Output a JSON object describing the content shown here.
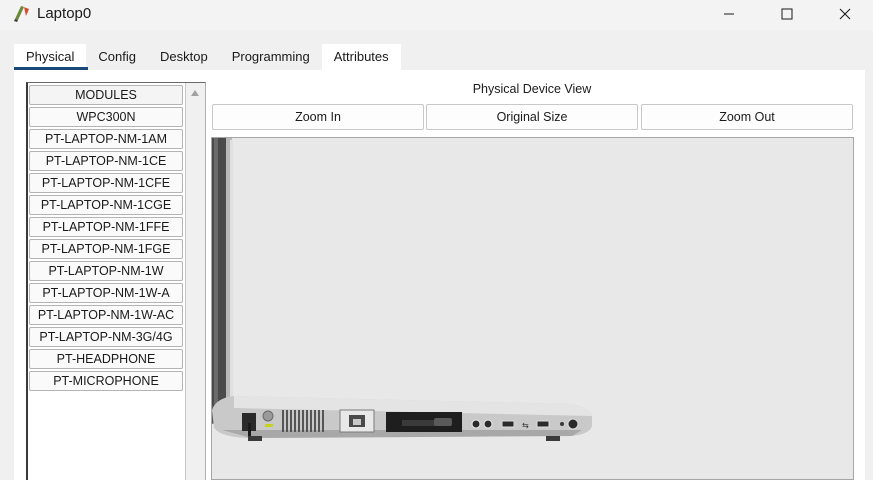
{
  "window": {
    "title": "Laptop0",
    "icon": "laptop-app-icon",
    "controls": [
      "minimize-icon",
      "maximize-icon",
      "close-icon"
    ]
  },
  "tabs": [
    {
      "label": "Physical",
      "active": true
    },
    {
      "label": "Config",
      "active": false
    },
    {
      "label": "Desktop",
      "active": false
    },
    {
      "label": "Programming",
      "active": false
    },
    {
      "label": "Attributes",
      "active": false
    }
  ],
  "modules": {
    "header": "MODULES",
    "items": [
      "WPC300N",
      "PT-LAPTOP-NM-1AM",
      "PT-LAPTOP-NM-1CE",
      "PT-LAPTOP-NM-1CFE",
      "PT-LAPTOP-NM-1CGE",
      "PT-LAPTOP-NM-1FFE",
      "PT-LAPTOP-NM-1FGE",
      "PT-LAPTOP-NM-1W",
      "PT-LAPTOP-NM-1W-A",
      "PT-LAPTOP-NM-1W-AC",
      "PT-LAPTOP-NM-3G/4G",
      "PT-HEADPHONE",
      "PT-MICROPHONE"
    ]
  },
  "physical_view": {
    "title": "Physical Device View",
    "zoom_in": "Zoom In",
    "original_size": "Original Size",
    "zoom_out": "Zoom Out"
  },
  "colors": {
    "tab_underline": "#1a4a7a",
    "viewport_bg": "#e8e8e8",
    "laptop_body": "#c8c8c8"
  }
}
